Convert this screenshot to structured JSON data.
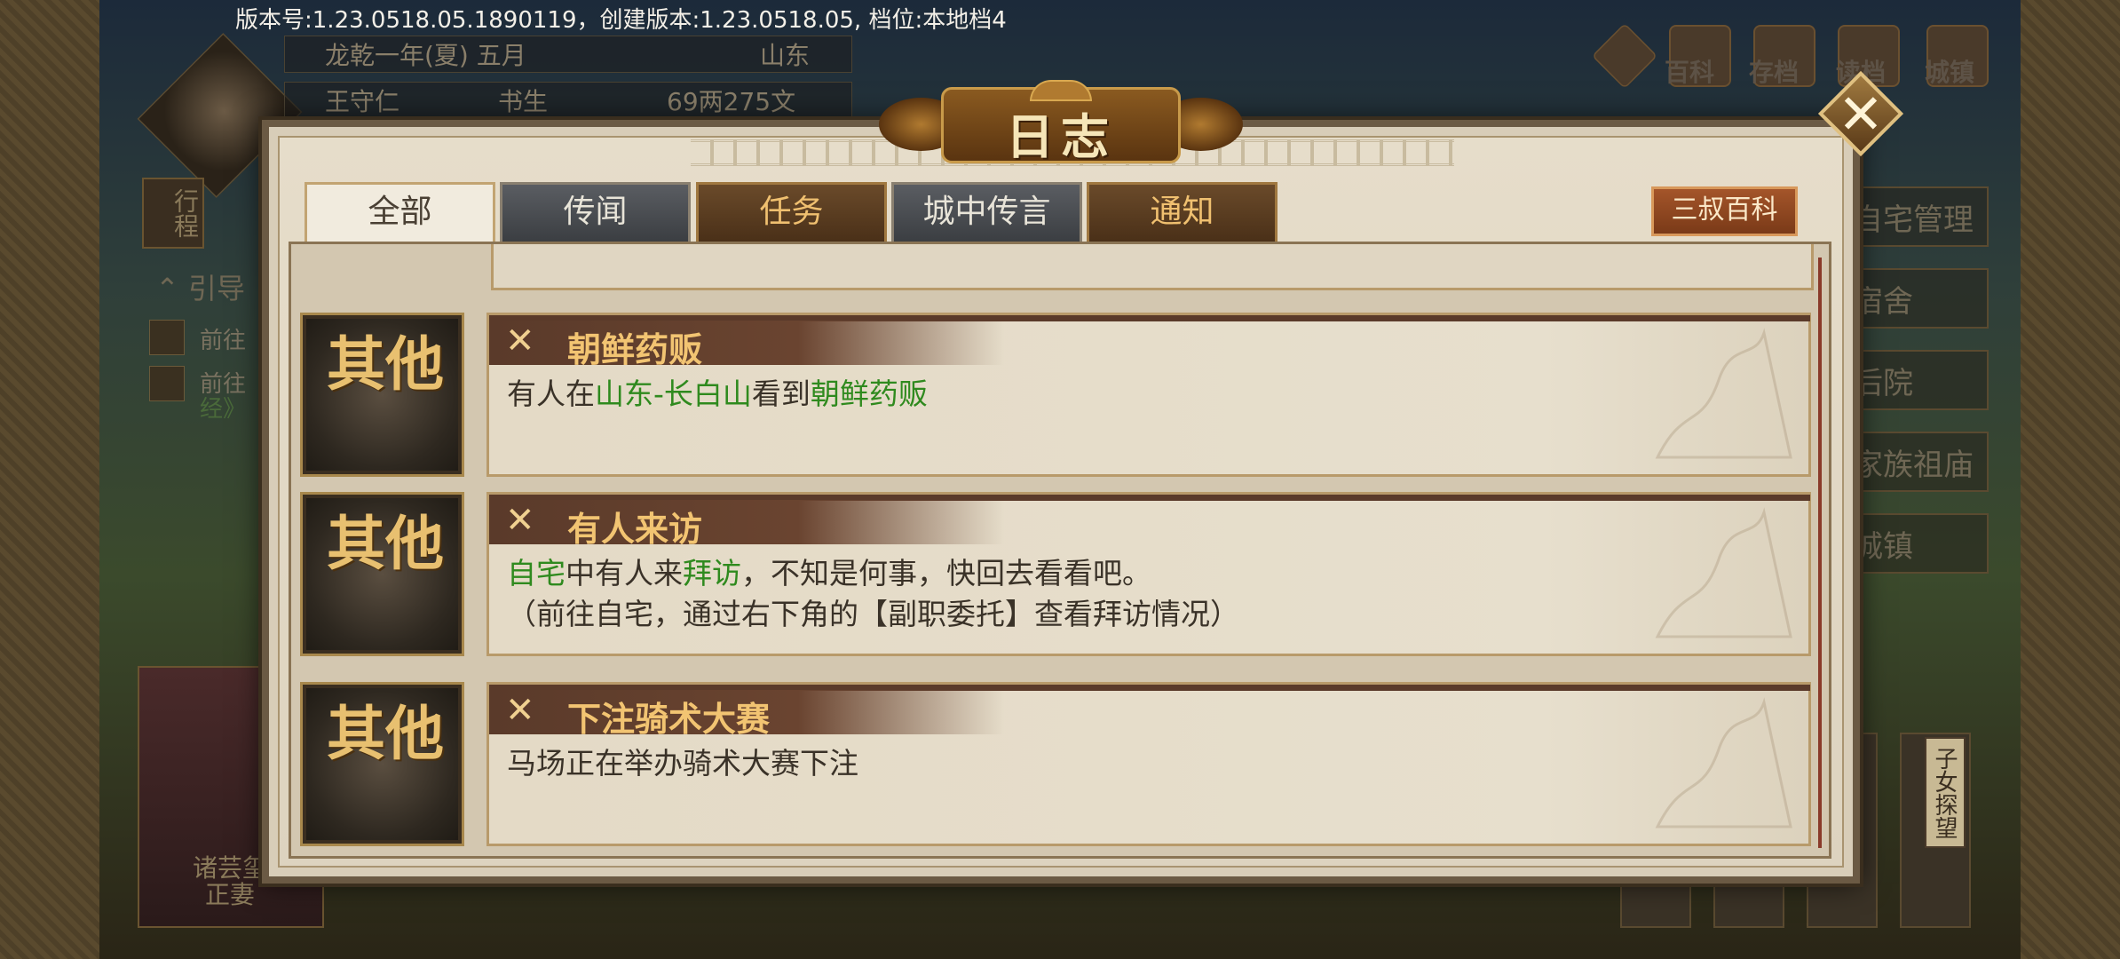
{
  "version_text": "版本号:1.23.0518.05.1890119，创建版本:1.23.0518.05, 档位:本地档4",
  "background": {
    "date_line": "龙乾一年(夏) 五月",
    "region": "山东",
    "player_name": "王守仁",
    "player_role": "书生",
    "money": "69两275文",
    "travel_label": "行程",
    "guide_label": "引导",
    "task_lines": [
      "前往",
      "前往",
      "经》"
    ],
    "top_icons": [
      "百科",
      "存档",
      "读档",
      "城镇"
    ],
    "right_menu": [
      "自宅管理",
      "宿舍",
      "后院",
      "家族祖庙",
      "城镇"
    ],
    "portrait_name_line1": "诸芸玺",
    "portrait_name_line2": "正妻",
    "child_visit_label": "子女探望"
  },
  "dialog": {
    "title": "日志",
    "close_icon": "close-icon",
    "tabs": [
      {
        "label": "全部",
        "state": "active"
      },
      {
        "label": "传闻",
        "state": "grey"
      },
      {
        "label": "任务",
        "state": "orange"
      },
      {
        "label": "城中传言",
        "state": "grey"
      },
      {
        "label": "通知",
        "state": "orange"
      }
    ],
    "sanshu_button": "三叔百科",
    "category_glyph": "其他",
    "entries": [
      {
        "title": "朝鲜药贩",
        "body_parts": [
          "有人在",
          "山东-长白山",
          "看到",
          "朝鲜药贩"
        ]
      },
      {
        "title": "有人来访",
        "body_parts": [
          "自宅",
          "中有人来",
          "拜访",
          "，不知是何事，快回去看看吧。"
        ],
        "body_line2": "（前往自宅，通过右下角的【副职委托】查看拜访情况）"
      },
      {
        "title": "下注骑术大赛",
        "body": "马场正在举办骑术大赛下注"
      }
    ]
  },
  "colors": {
    "highlight_green": "#2f8a1e",
    "title_gold": "#f2c472",
    "sanshu_button": "#a4552a"
  }
}
